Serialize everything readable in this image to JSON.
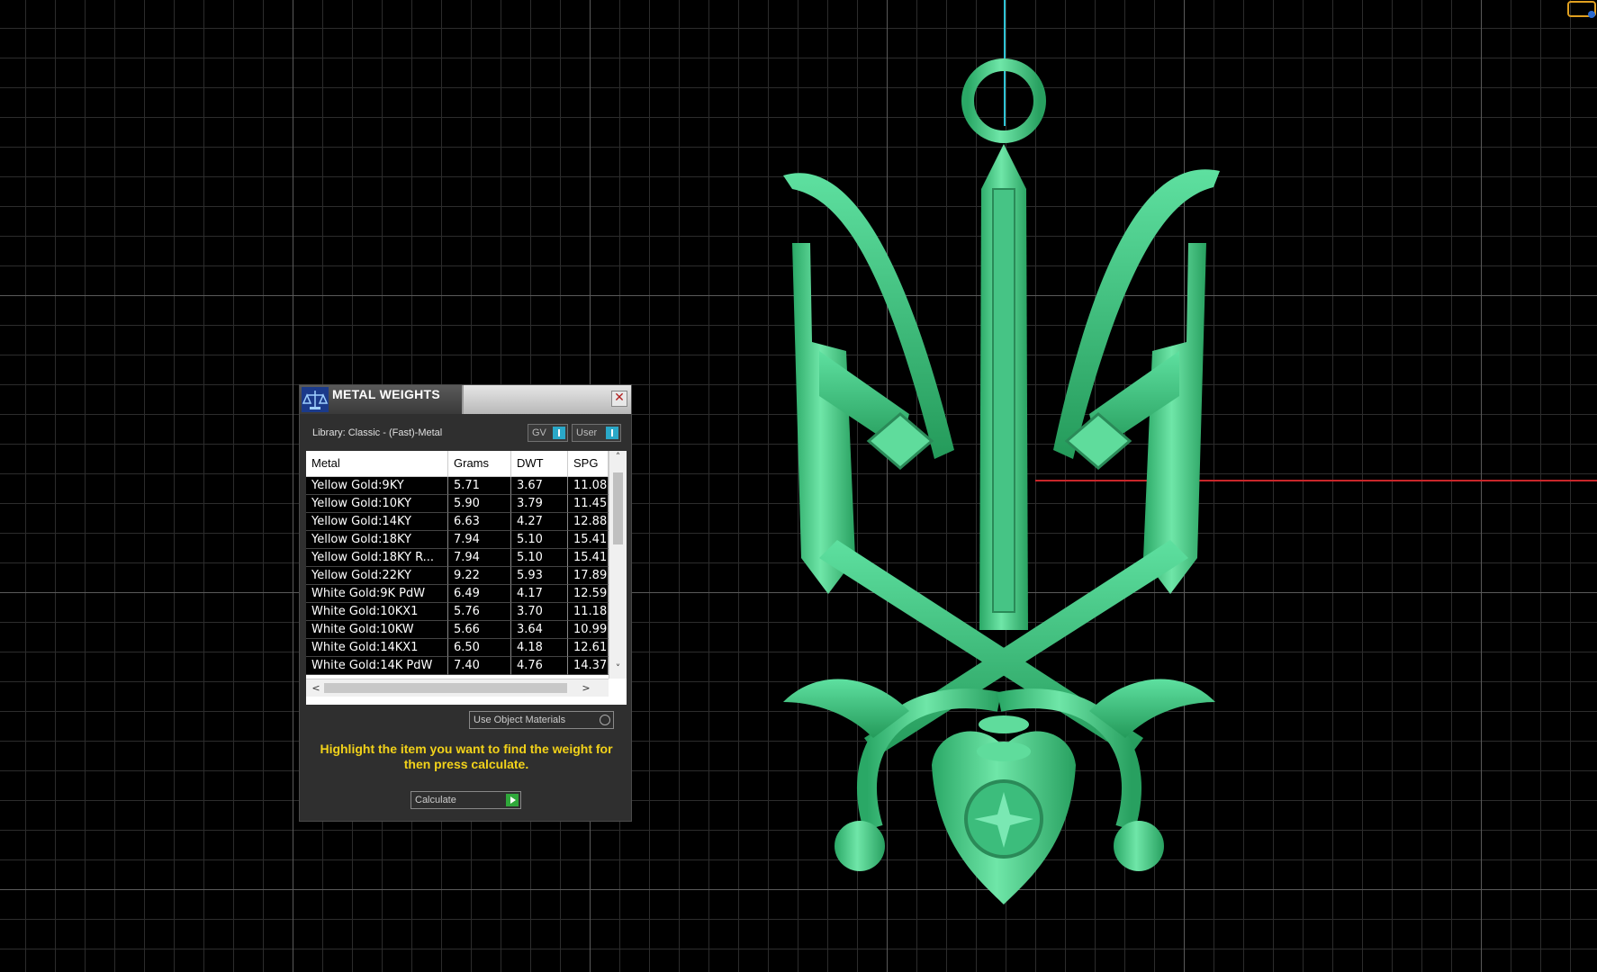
{
  "dialog": {
    "title": "METAL WEIGHTS",
    "close_glyph": "✕",
    "library_label": "Library: Classic - (Fast)-Metal",
    "unit_buttons": [
      "GV",
      "User"
    ],
    "table": {
      "headers": [
        "Metal",
        "Grams",
        "DWT",
        "SPG"
      ],
      "rows": [
        [
          "Yellow Gold:9KY",
          "5.71",
          "3.67",
          "11.08"
        ],
        [
          "Yellow Gold:10KY",
          "5.90",
          "3.79",
          "11.45"
        ],
        [
          "Yellow Gold:14KY",
          "6.63",
          "4.27",
          "12.88"
        ],
        [
          "Yellow Gold:18KY",
          "7.94",
          "5.10",
          "15.41"
        ],
        [
          "Yellow Gold:18KY R...",
          "7.94",
          "5.10",
          "15.41"
        ],
        [
          "Yellow Gold:22KY",
          "9.22",
          "5.93",
          "17.89"
        ],
        [
          "White Gold:9K PdW",
          "6.49",
          "4.17",
          "12.59"
        ],
        [
          "White Gold:10KX1",
          "5.76",
          "3.70",
          "11.18"
        ],
        [
          "White Gold:10KW",
          "5.66",
          "3.64",
          "10.99"
        ],
        [
          "White Gold:14KX1",
          "6.50",
          "4.18",
          "12.61"
        ],
        [
          "White Gold:14K PdW",
          "7.40",
          "4.76",
          "14.37"
        ]
      ],
      "scroll_up": "˄",
      "scroll_down": "˅",
      "scroll_left": "<",
      "scroll_right": ">"
    },
    "use_object_materials_label": "Use Object Materials",
    "instruction": "Highlight the item you want to find the weight for then press calculate.",
    "calculate_label": "Calculate"
  },
  "icons": {
    "logo": "scale-logo-icon",
    "close": "close-icon",
    "calculate": "play-icon"
  },
  "colors": {
    "model": "#3ec97e",
    "axis_y": "#2ec4d6",
    "axis_x": "#c8262a",
    "instruction": "#f2d21a"
  }
}
